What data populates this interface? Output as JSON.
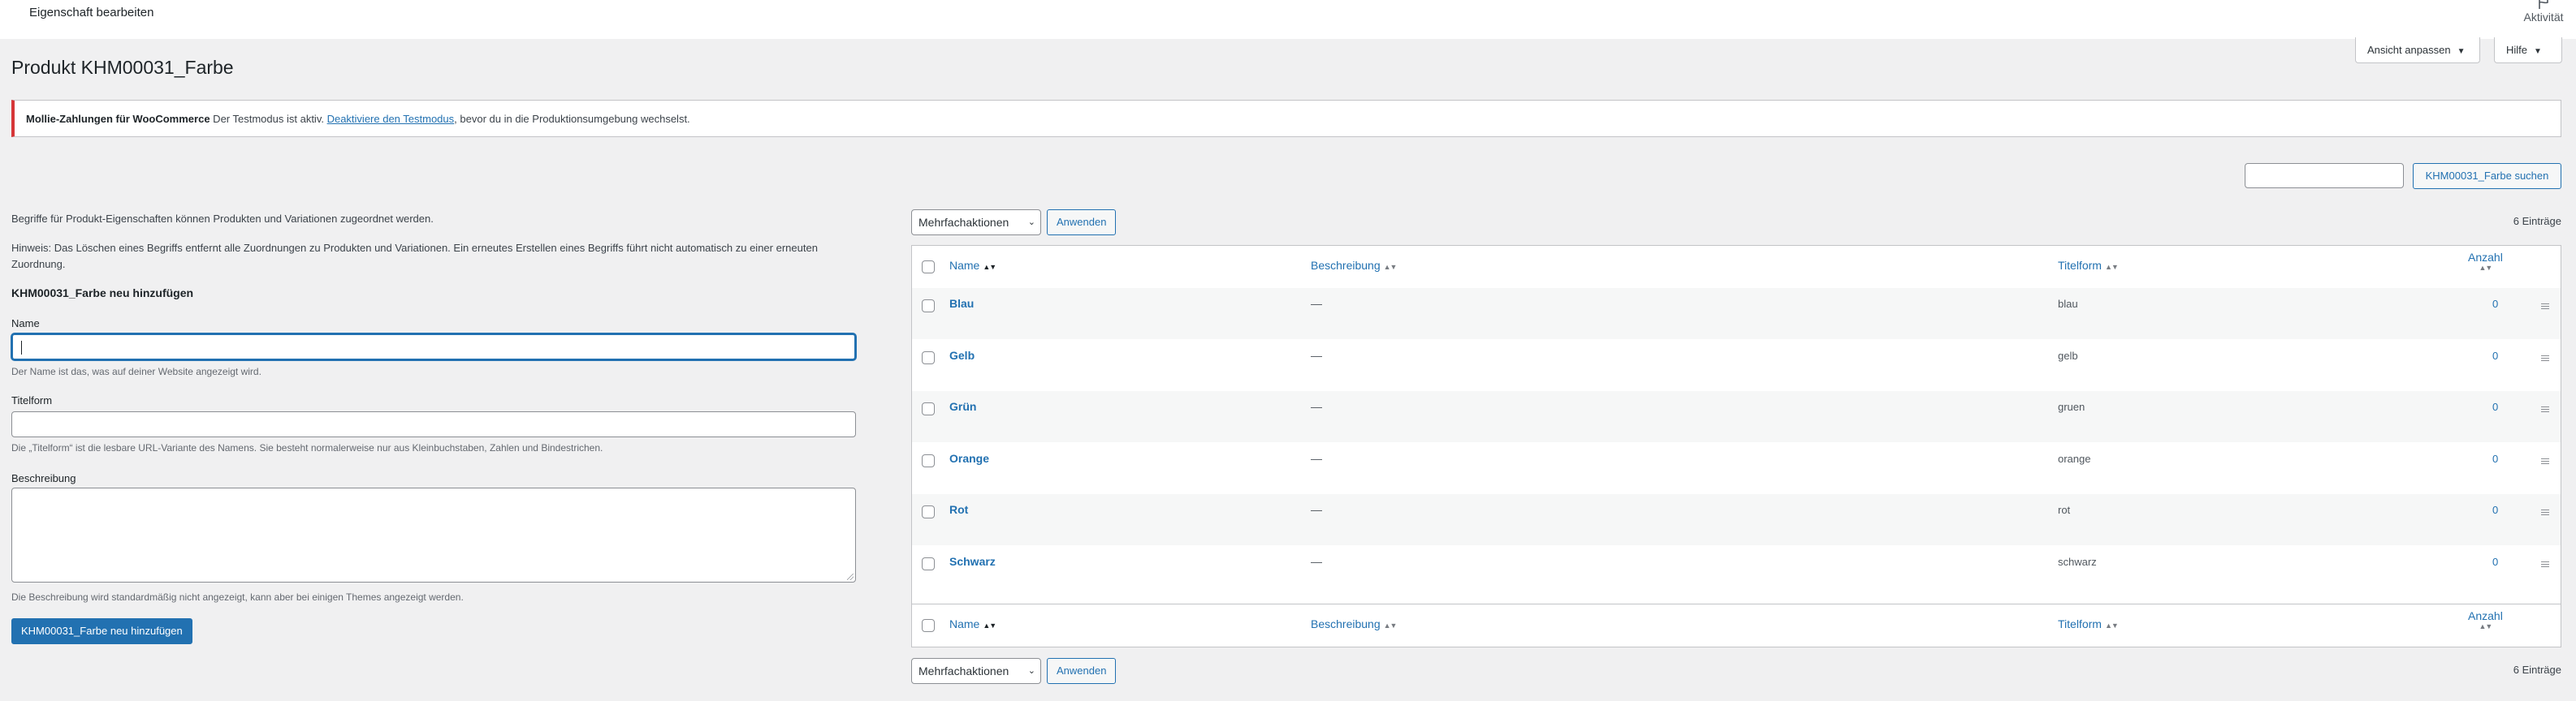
{
  "topbar": {
    "title": "Eigenschaft bearbeiten",
    "activity_label": "Aktivität"
  },
  "screen_options": {
    "view_label": "Ansicht anpassen",
    "help_label": "Hilfe"
  },
  "page": {
    "title": "Produkt KHM00031_Farbe"
  },
  "notice": {
    "strong": "Mollie-Zahlungen für WooCommerce",
    "text_before": " Der Testmodus ist aktiv. ",
    "link": "Deaktiviere den Testmodus",
    "text_after": ", bevor du in die Produktionsumgebung wechselst."
  },
  "search": {
    "value": "",
    "button_label": "KHM00031_Farbe suchen"
  },
  "form": {
    "intro": "Begriffe für Produkt-Eigenschaften können Produkten und Variationen zugeordnet werden.",
    "hint": "Hinweis: Das Löschen eines Begriffs entfernt alle Zuordnungen zu Produkten und Variationen. Ein erneutes Erstellen eines Begriffs führt nicht automatisch zu einer erneuten Zuordnung.",
    "heading": "KHM00031_Farbe neu hinzufügen",
    "name_label": "Name",
    "name_value": "",
    "name_desc": "Der Name ist das, was auf deiner Website angezeigt wird.",
    "slug_label": "Titelform",
    "slug_value": "",
    "slug_desc": "Die „Titelform“ ist die lesbare URL-Variante des Namens. Sie besteht normalerweise nur aus Kleinbuchstaben, Zahlen und Bindestrichen.",
    "desc_label": "Beschreibung",
    "desc_value": "",
    "desc_desc": "Die Beschreibung wird standardmäßig nicht angezeigt, kann aber bei einigen Themes angezeigt werden.",
    "submit_label": "KHM00031_Farbe neu hinzufügen"
  },
  "bulk": {
    "selected": "Mehrfachaktionen",
    "apply_label": "Anwenden",
    "count": "6 Einträge"
  },
  "table": {
    "columns": {
      "name": "Name",
      "description": "Beschreibung",
      "slug": "Titelform",
      "count": "Anzahl"
    },
    "rows": [
      {
        "name": "Blau",
        "description": "—",
        "slug": "blau",
        "count": "0"
      },
      {
        "name": "Gelb",
        "description": "—",
        "slug": "gelb",
        "count": "0"
      },
      {
        "name": "Grün",
        "description": "—",
        "slug": "gruen",
        "count": "0"
      },
      {
        "name": "Orange",
        "description": "—",
        "slug": "orange",
        "count": "0"
      },
      {
        "name": "Rot",
        "description": "—",
        "slug": "rot",
        "count": "0"
      },
      {
        "name": "Schwarz",
        "description": "—",
        "slug": "schwarz",
        "count": "0"
      }
    ]
  },
  "colors": {
    "accent": "#2271b1",
    "notice_error": "#d63638",
    "background": "#f0f0f1"
  }
}
